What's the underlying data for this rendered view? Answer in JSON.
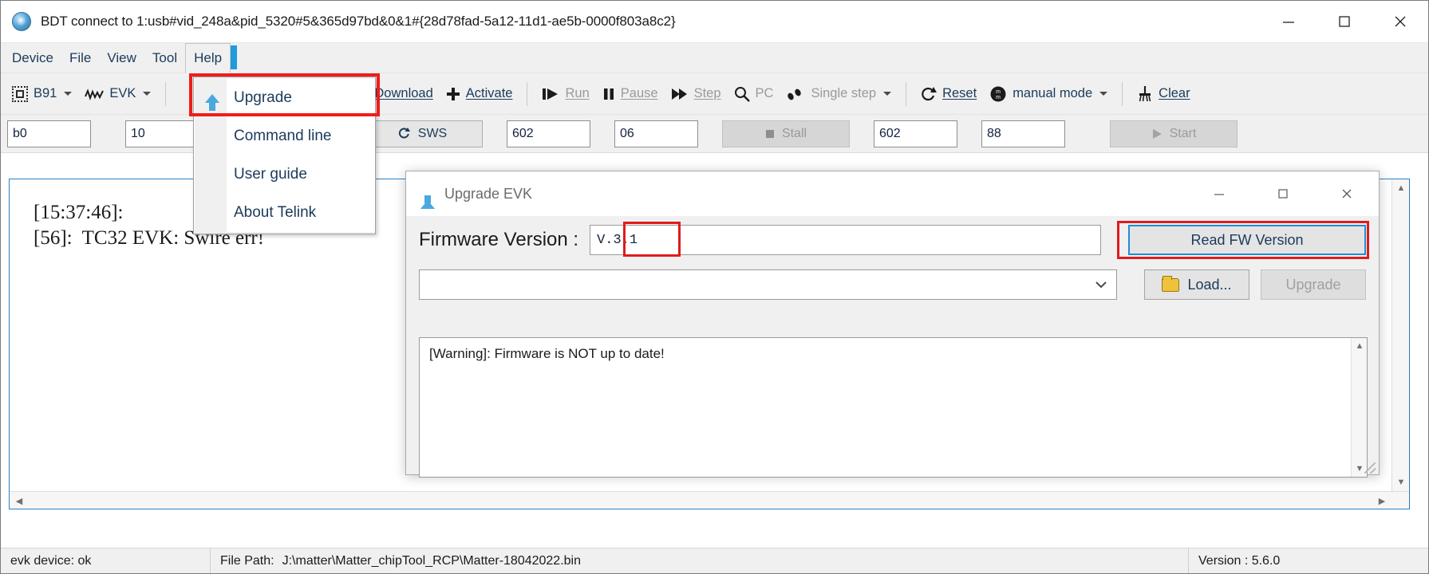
{
  "window": {
    "title": "BDT connect to 1:usb#vid_248a&pid_5320#5&365d97bd&0&1#{28d78fad-5a12-11d1-ae5b-0000f803a8c2}",
    "icon": "bdt-app-icon",
    "minimize": "minimize-icon",
    "maximize": "maximize-icon",
    "close": "close-icon"
  },
  "menubar": {
    "items": [
      {
        "label": "Device"
      },
      {
        "label": "File"
      },
      {
        "label": "View"
      },
      {
        "label": "Tool"
      },
      {
        "label": "Help",
        "open": true
      }
    ]
  },
  "help_menu": {
    "items": [
      {
        "label": "Upgrade",
        "icon": "upload-arrow-icon",
        "highlighted": true
      },
      {
        "label": "Command line",
        "icon": "console-icon"
      },
      {
        "label": "User guide",
        "icon": "question-help-icon"
      },
      {
        "label": "About Telink",
        "icon": "about-info-icon"
      }
    ],
    "highlight_color": "#ef1c1c"
  },
  "toolbar": {
    "chip_label": "B91",
    "evk_label": "EVK",
    "download_label": "Download",
    "activate_label": "Activate",
    "run_label": "Run",
    "pause_label": "Pause",
    "step_label": "Step",
    "pc_label": "PC",
    "single_step_label": "Single step",
    "reset_label": "Reset",
    "manual_mode_label": "manual mode",
    "clear_label": "Clear"
  },
  "fieldrow": {
    "addr_value": "b0",
    "len_value": "10",
    "blank_value": "",
    "sws_label": "SWS",
    "f602a_value": "602",
    "f06_value": "06",
    "stall_label": "Stall",
    "f602b_value": "602",
    "f88_value": "88",
    "start_label": "Start"
  },
  "log": {
    "lines": "[15:37:46]:\n[56]:  TC32 EVK: Swire err!"
  },
  "dialog": {
    "title": "Upgrade EVK",
    "icon": "upload-arrow-icon",
    "minimize": "minimize-icon",
    "maximize": "maximize-icon",
    "close": "close-icon",
    "fw_label": "Firmware Version :",
    "fw_value": "V.3.1",
    "combo_value": "",
    "read_fw_label": "Read FW Version",
    "load_label": "Load...",
    "upgrade_label": "Upgrade",
    "log_text": "[Warning]: Firmware is NOT up to date!",
    "accent_blue": "#1a8fd8",
    "highlight_red": "#e01b1b"
  },
  "statusbar": {
    "device_status": "evk device: ok",
    "file_path_label": "File Path:",
    "file_path_value": "J:\\matter\\Matter_chipTool_RCP\\Matter-18042022.bin",
    "version": "Version : 5.6.0"
  }
}
